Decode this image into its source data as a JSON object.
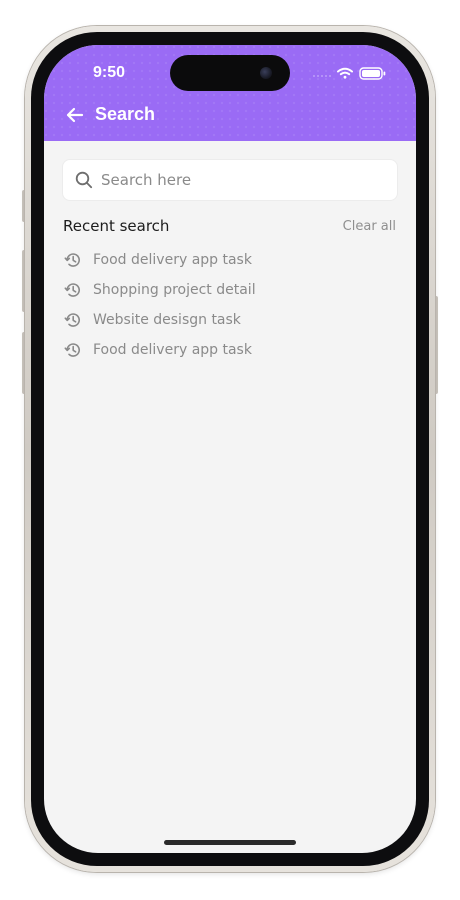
{
  "status_bar": {
    "time": "9:50"
  },
  "header": {
    "title": "Search",
    "back_icon": "arrow-left-icon",
    "background_color": "#9a6bf5"
  },
  "search": {
    "placeholder": "Search here",
    "value": "",
    "icon": "search-icon"
  },
  "recent": {
    "title": "Recent search",
    "clear_label": "Clear all",
    "item_icon": "history-icon",
    "items": [
      {
        "label": "Food delivery app task"
      },
      {
        "label": "Shopping project detail"
      },
      {
        "label": "Website desisgn task"
      },
      {
        "label": "Food delivery app task"
      }
    ]
  },
  "colors": {
    "accent": "#9a6bf5",
    "screen_background": "#f4f4f4",
    "muted_text": "#8a8a8a"
  }
}
